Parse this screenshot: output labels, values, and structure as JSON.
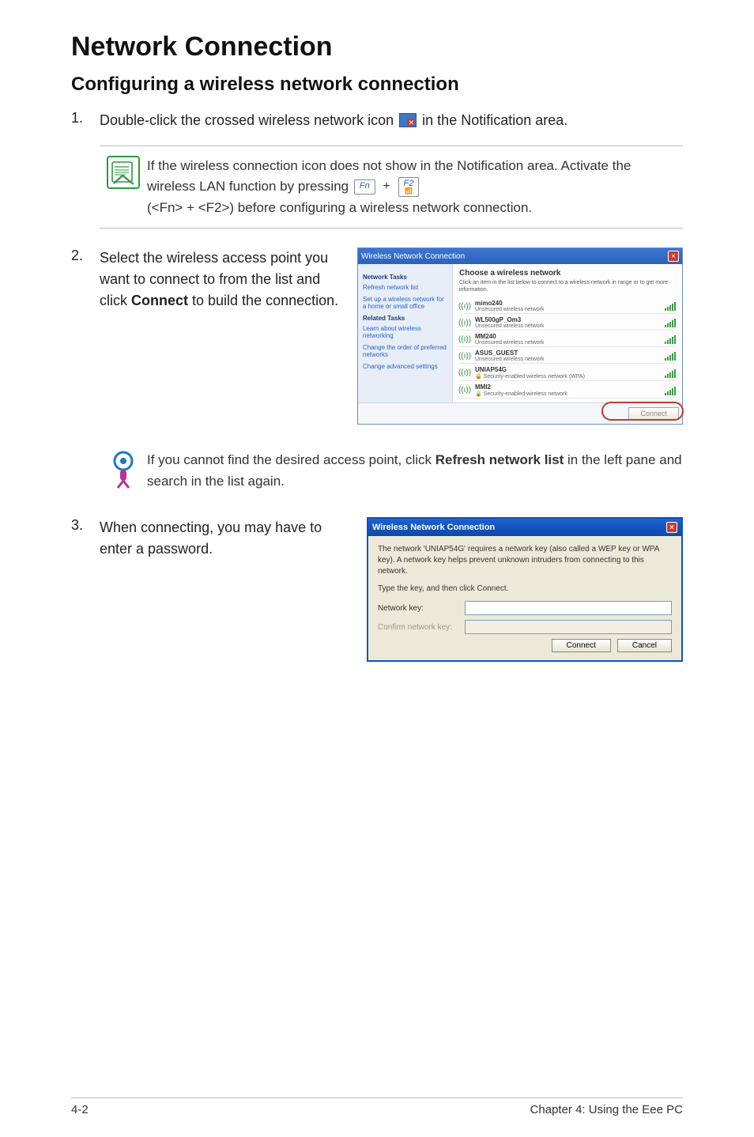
{
  "title": "Network Connection",
  "subtitle": "Configuring a wireless network connection",
  "steps": {
    "s1": {
      "num": "1.",
      "pre": "Double-click the crossed wireless network icon ",
      "post": " in the Notification area."
    },
    "note1": {
      "line1": "If the wireless connection icon does not show in the Notification area. Activate the wireless LAN function by pressing ",
      "key1": "Fn",
      "key2": "F2",
      "line2": "(<Fn> + <F2>) before configuring a wireless network connection."
    },
    "s2": {
      "num": "2.",
      "text_a": "Select the wireless access point you want to connect to from the list and click ",
      "text_bold": "Connect",
      "text_b": " to build the connection."
    },
    "tip": {
      "text_a": "If you cannot find the desired access point, click ",
      "bold": "Refresh network list",
      "text_b": " in the left pane and search in the list again."
    },
    "s3": {
      "num": "3.",
      "text": "When connecting, you may have to enter a password."
    }
  },
  "xp_list_window": {
    "title": "Wireless Network Connection",
    "side": {
      "tasks_h": "Network Tasks",
      "refresh": "Refresh network list",
      "setup": "Set up a wireless network for a home or small office",
      "related_h": "Related Tasks",
      "learn": "Learn about wireless networking",
      "changeorder": "Change the order of preferred networks",
      "advanced": "Change advanced settings"
    },
    "main_h": "Choose a wireless network",
    "main_sub": "Click an item in the list below to connect to a wireless network in range or to get more information.",
    "networks": [
      {
        "name": "mimo240",
        "sub": "Unsecured wireless network"
      },
      {
        "name": "WL500gP_Om3",
        "sub": "Unsecured wireless network"
      },
      {
        "name": "MM240",
        "sub": "Unsecured wireless network"
      },
      {
        "name": "ASUS_GUEST",
        "sub": "Unsecured wireless network"
      },
      {
        "name": "UNIAP54G",
        "sub": "Security-enabled wireless network (WPA)"
      },
      {
        "name": "MMI2",
        "sub": "Security-enabled wireless network"
      }
    ],
    "connect_btn": "Connect"
  },
  "xp_password_dialog": {
    "title": "Wireless Network Connection",
    "msg": "The network 'UNIAP54G' requires a network key (also called a WEP key or WPA key). A network key helps prevent unknown intruders from connecting to this network.",
    "instr": "Type the key, and then click Connect.",
    "label_key": "Network key:",
    "label_confirm": "Confirm network key:",
    "btn_connect": "Connect",
    "btn_cancel": "Cancel"
  },
  "footer": {
    "left": "4-2",
    "right": "Chapter 4: Using the Eee PC"
  }
}
